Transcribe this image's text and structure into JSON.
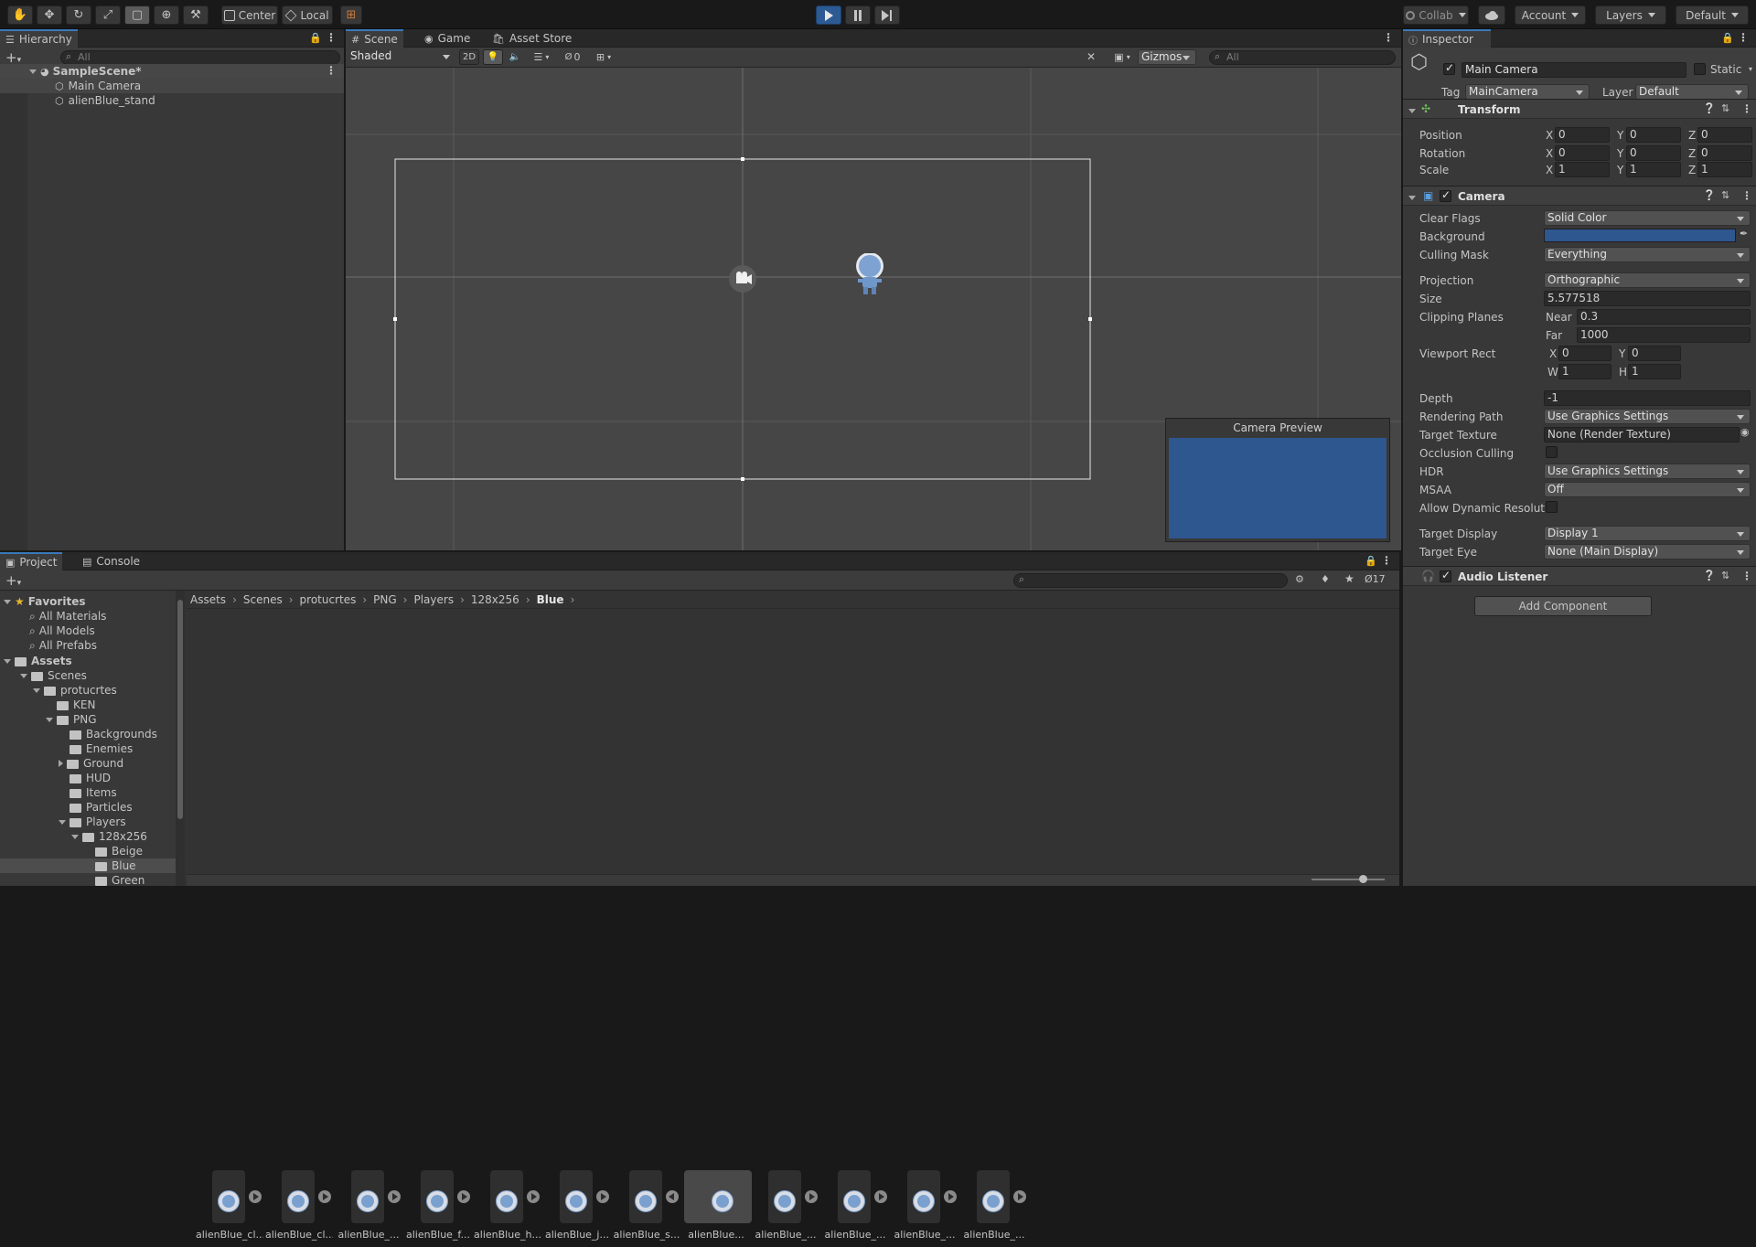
{
  "toolbar": {
    "tools": [
      "hand-tool",
      "move-tool",
      "rotate-tool",
      "scale-tool",
      "rect-tool",
      "transform-tool",
      "custom-tool"
    ],
    "pivot": "Center",
    "space": "Local",
    "collab": "Collab",
    "account": "Account",
    "layers": "Layers",
    "layout": "Default"
  },
  "hierarchy": {
    "tab": "Hierarchy",
    "search_placeholder": "All",
    "scene": "SampleScene*",
    "items": [
      "Main Camera",
      "alienBlue_stand"
    ]
  },
  "scene_view": {
    "tabs": [
      "Scene",
      "Game",
      "Asset Store"
    ],
    "shading": "Shaded",
    "mode_2d": "2D",
    "hidden_count": "0",
    "gizmos": "Gizmos",
    "search_placeholder": "All",
    "camera_preview_title": "Camera Preview",
    "preview_color": "#2e568f"
  },
  "inspector": {
    "tab": "Inspector",
    "object_name": "Main Camera",
    "static_label": "Static",
    "tag_label": "Tag",
    "tag_value": "MainCamera",
    "layer_label": "Layer",
    "layer_value": "Default",
    "transform": {
      "title": "Transform",
      "rows": [
        {
          "label": "Position",
          "x": "0",
          "y": "0",
          "z": "0"
        },
        {
          "label": "Rotation",
          "x": "0",
          "y": "0",
          "z": "0"
        },
        {
          "label": "Scale",
          "x": "1",
          "y": "1",
          "z": "1"
        }
      ]
    },
    "camera": {
      "title": "Camera",
      "clear_flags_label": "Clear Flags",
      "clear_flags": "Solid Color",
      "background_label": "Background",
      "background_color": "#2e568f",
      "culling_mask_label": "Culling Mask",
      "culling_mask": "Everything",
      "projection_label": "Projection",
      "projection": "Orthographic",
      "size_label": "Size",
      "size": "5.577518",
      "clipping_label": "Clipping Planes",
      "near_label": "Near",
      "near": "0.3",
      "far_label": "Far",
      "far": "1000",
      "viewport_label": "Viewport Rect",
      "vx": "0",
      "vy": "0",
      "vw": "1",
      "vh": "1",
      "depth_label": "Depth",
      "depth": "-1",
      "rendering_path_label": "Rendering Path",
      "rendering_path": "Use Graphics Settings",
      "target_texture_label": "Target Texture",
      "target_texture": "None (Render Texture)",
      "occlusion_label": "Occlusion Culling",
      "hdr_label": "HDR",
      "hdr": "Use Graphics Settings",
      "msaa_label": "MSAA",
      "msaa": "Off",
      "dynres_label": "Allow Dynamic Resolutio",
      "target_display_label": "Target Display",
      "target_display": "Display 1",
      "target_eye_label": "Target Eye",
      "target_eye": "None (Main Display)"
    },
    "audio_listener": "Audio Listener",
    "add_component": "Add Component"
  },
  "project": {
    "tabs": [
      "Project",
      "Console"
    ],
    "badge_count": "17",
    "favorites": {
      "title": "Favorites",
      "items": [
        "All Materials",
        "All Models",
        "All Prefabs"
      ]
    },
    "assets_title": "Assets",
    "tree": [
      {
        "label": "Scenes",
        "depth": 1,
        "open": true
      },
      {
        "label": "protucrtes",
        "depth": 2,
        "open": true
      },
      {
        "label": "KEN",
        "depth": 3,
        "open": null
      },
      {
        "label": "PNG",
        "depth": 3,
        "open": true
      },
      {
        "label": "Backgrounds",
        "depth": 4,
        "open": null
      },
      {
        "label": "Enemies",
        "depth": 4,
        "open": null
      },
      {
        "label": "Ground",
        "depth": 4,
        "open": false
      },
      {
        "label": "HUD",
        "depth": 4,
        "open": null
      },
      {
        "label": "Items",
        "depth": 4,
        "open": null
      },
      {
        "label": "Particles",
        "depth": 4,
        "open": null
      },
      {
        "label": "Players",
        "depth": 4,
        "open": true
      },
      {
        "label": "128x256",
        "depth": 5,
        "open": true
      },
      {
        "label": "Beige",
        "depth": 6,
        "open": null
      },
      {
        "label": "Blue",
        "depth": 6,
        "open": null,
        "selected": true
      },
      {
        "label": "Green",
        "depth": 6,
        "open": null
      }
    ],
    "breadcrumb": [
      "Assets",
      "Scenes",
      "protucrtes",
      "PNG",
      "Players",
      "128x256",
      "Blue"
    ],
    "assets": [
      "alienBlue_cl...",
      "alienBlue_cl...",
      "alienBlue_...",
      "alienBlue_f...",
      "alienBlue_h...",
      "alienBlue_j...",
      "alienBlue_s...",
      "alienBlue...",
      "alienBlue_...",
      "alienBlue_...",
      "alienBlue_...",
      "alienBlue_..."
    ]
  }
}
